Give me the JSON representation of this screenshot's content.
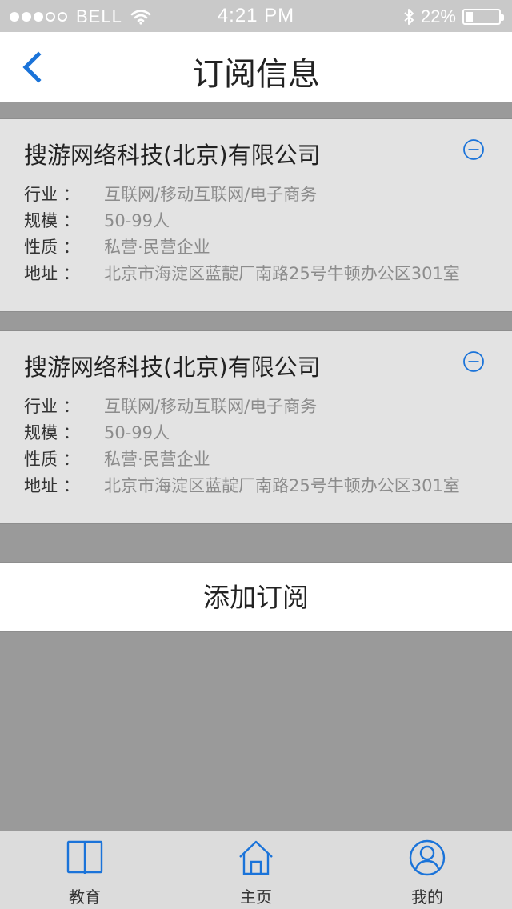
{
  "status_bar": {
    "carrier": "BELL",
    "time": "4:21 PM",
    "battery_percent": "22%",
    "battery_level": 0.22,
    "signal_bars_filled": 3,
    "signal_bars_total": 5,
    "icons": [
      "signal-dots-icon",
      "wifi-icon",
      "bluetooth-icon",
      "battery-icon"
    ]
  },
  "nav": {
    "title": "订阅信息",
    "back_icon": "chevron-left-icon"
  },
  "subscriptions": [
    {
      "company": "搜游网络科技(北京)有限公司",
      "fields": [
        {
          "label": "行业 ：",
          "value": "互联网/移动互联网/电子商务"
        },
        {
          "label": "规模 ：",
          "value": "50-99人"
        },
        {
          "label": "性质 ：",
          "value": "私营·民营企业"
        },
        {
          "label": "地址 ：",
          "value": "北京市海淀区蓝靛厂南路25号牛顿办公区301室"
        }
      ]
    },
    {
      "company": "搜游网络科技(北京)有限公司",
      "fields": [
        {
          "label": "行业 ：",
          "value": "互联网/移动互联网/电子商务"
        },
        {
          "label": "规模 ：",
          "value": "50-99人"
        },
        {
          "label": "性质 ：",
          "value": "私营·民营企业"
        },
        {
          "label": "地址 ：",
          "value": "北京市海淀区蓝靛厂南路25号牛顿办公区301室"
        }
      ]
    }
  ],
  "add_button_label": "添加订阅",
  "tabs": [
    {
      "label": "教育",
      "icon": "book-icon"
    },
    {
      "label": "主页",
      "icon": "home-icon"
    },
    {
      "label": "我的",
      "icon": "user-icon"
    }
  ],
  "colors": {
    "accent": "#1a73d9",
    "background": "#9a9a9a",
    "card": "#e3e3e3",
    "value_text": "#8c8c8c"
  }
}
